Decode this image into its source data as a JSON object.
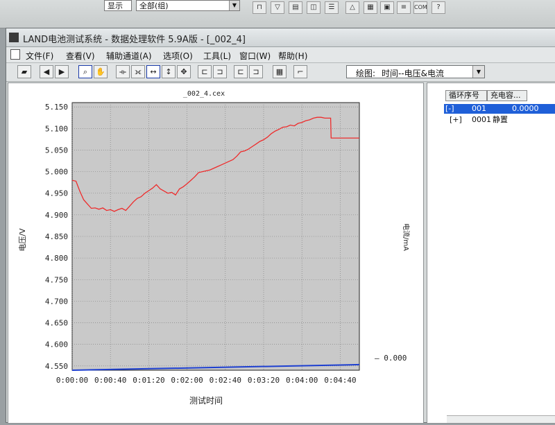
{
  "background_toolbar": {
    "combo_left_value": "显示",
    "combo_right_value": "全部(组)",
    "icons": [
      "filter-icon",
      "cup-icon",
      "doc-icon",
      "cube-icon",
      "list-icon",
      "cone-icon",
      "chart-icon",
      "image-icon",
      "stack-icon",
      "com-icon",
      "help-icon"
    ],
    "com_label": "COM",
    "help_label": "?"
  },
  "window": {
    "title": "LAND电池测试系统 - 数据处理软件 5.9A版 - [_002_4]"
  },
  "menu": [
    {
      "label": "文件(F)"
    },
    {
      "label": "查看(V)"
    },
    {
      "label": "辅助通道(A)"
    },
    {
      "label": "选项(O)"
    },
    {
      "label": "工具(L)"
    },
    {
      "label": "窗口(W)"
    },
    {
      "label": "帮助(H)"
    }
  ],
  "toolbar": {
    "plot_label": "绘图:",
    "plot_value": "时间--电压&电流"
  },
  "chart_data": {
    "type": "line",
    "title": "_002_4.cex",
    "xlabel": "测试时间",
    "ylabel": "电压/V",
    "y2label": "电流/mA",
    "x_ticks": [
      "0:00:00",
      "0:00:40",
      "0:01:20",
      "0:02:00",
      "0:02:40",
      "0:03:20",
      "0:04:00",
      "0:04:40"
    ],
    "y_ticks": [
      "5.150",
      "5.100",
      "5.050",
      "5.000",
      "4.950",
      "4.900",
      "4.850",
      "4.800",
      "4.750",
      "4.700",
      "4.650",
      "4.600",
      "4.550"
    ],
    "y2_ticks": [
      "0.000"
    ],
    "xlim": [
      0,
      300
    ],
    "ylim": [
      4.54,
      5.16
    ],
    "grid": true,
    "series": [
      {
        "color": "#ee2b2b",
        "x": [
          0,
          4,
          8,
          12,
          16,
          20,
          24,
          28,
          32,
          36,
          40,
          44,
          48,
          52,
          56,
          60,
          64,
          68,
          72,
          76,
          80,
          84,
          88,
          92,
          96,
          100,
          104,
          108,
          112,
          116,
          120,
          124,
          128,
          132,
          136,
          140,
          144,
          148,
          152,
          156,
          160,
          164,
          168,
          172,
          176,
          180,
          184,
          188,
          192,
          196,
          200,
          204,
          208,
          212,
          216,
          220,
          224,
          228,
          232,
          236,
          240,
          244,
          248,
          252,
          256,
          260,
          264,
          268,
          270,
          270.5,
          276,
          282,
          288,
          294,
          300
        ],
        "y": [
          4.98,
          4.978,
          4.955,
          4.935,
          4.925,
          4.915,
          4.916,
          4.913,
          4.916,
          4.91,
          4.912,
          4.908,
          4.912,
          4.915,
          4.91,
          4.92,
          4.93,
          4.938,
          4.942,
          4.95,
          4.956,
          4.962,
          4.97,
          4.96,
          4.955,
          4.95,
          4.952,
          4.946,
          4.96,
          4.965,
          4.972,
          4.98,
          4.988,
          4.998,
          5.0,
          5.002,
          5.004,
          5.008,
          5.012,
          5.016,
          5.02,
          5.024,
          5.028,
          5.036,
          5.046,
          5.048,
          5.052,
          5.058,
          5.064,
          5.07,
          5.074,
          5.08,
          5.088,
          5.094,
          5.098,
          5.103,
          5.104,
          5.108,
          5.106,
          5.112,
          5.114,
          5.118,
          5.12,
          5.124,
          5.126,
          5.126,
          5.124,
          5.124,
          5.124,
          5.078,
          5.078,
          5.078,
          5.078,
          5.078,
          5.078
        ]
      },
      {
        "color": "#1d3fd1",
        "x": [
          0,
          300
        ],
        "y": [
          4.54,
          4.553
        ],
        "axis": "right"
      }
    ]
  },
  "tree": {
    "columns": [
      "循环序号",
      "充电容..."
    ],
    "rows": [
      {
        "expander": "[-]",
        "id": "001",
        "value": "0.0000",
        "selected": true
      },
      {
        "expander": "[+]",
        "id": "0001",
        "value": "静置",
        "selected": false
      }
    ]
  }
}
